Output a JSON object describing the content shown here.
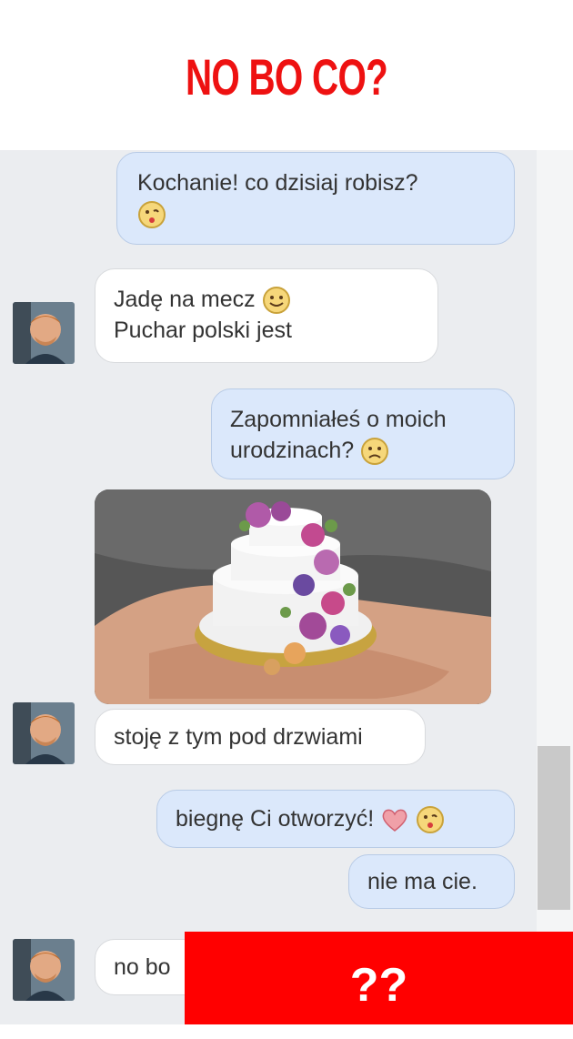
{
  "header": {
    "title": "NO BO CO?"
  },
  "messages": [
    {
      "side": "out",
      "line1": "Kochanie! co dzisiaj robisz?",
      "emoji": "kiss-face"
    },
    {
      "side": "in",
      "line1": "Jadę na mecz",
      "line1_emoji": "smile-face",
      "line2": "Puchar polski jest"
    },
    {
      "side": "out",
      "line1": "Zapomniałeś o moich",
      "line2": "urodzinach?",
      "line2_emoji": "sad-face"
    },
    {
      "side": "in",
      "type": "image",
      "image_desc": "cake"
    },
    {
      "side": "in",
      "line1": "stoję z tym pod drzwiami"
    },
    {
      "side": "out",
      "line1": "biegnę Ci otworzyć!",
      "emojis": [
        "heart",
        "kiss-face"
      ]
    },
    {
      "side": "out",
      "line1": "nie ma cie."
    },
    {
      "side": "in",
      "line1": "no bo"
    }
  ],
  "banner": {
    "text": "??"
  },
  "colors": {
    "title": "#ee1111",
    "outgoing_bubble": "#dbe8fb",
    "incoming_bubble": "#ffffff",
    "chat_background": "#ebedf0",
    "banner": "#ff0000"
  }
}
